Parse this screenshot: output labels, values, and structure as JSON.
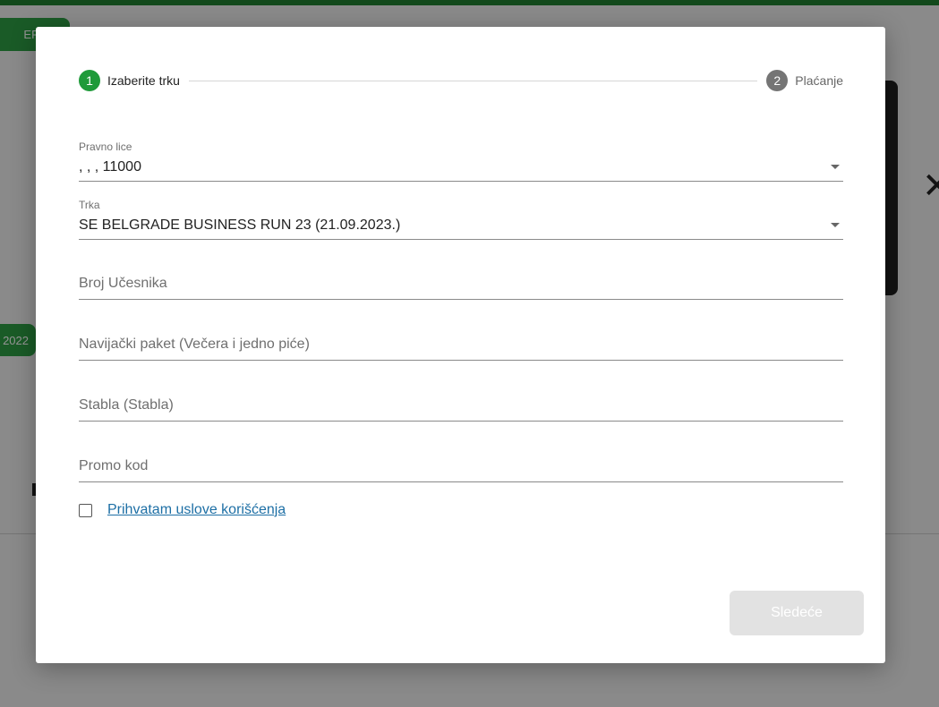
{
  "background": {
    "pill_top": "ERVAC",
    "pill_mid": "2022",
    "close_glyph": "✕"
  },
  "stepper": {
    "steps": [
      {
        "number": "1",
        "label": "Izaberite trku",
        "state": "active"
      },
      {
        "number": "2",
        "label": "Plaćanje",
        "state": "inactive"
      }
    ]
  },
  "form": {
    "legal_entity": {
      "label": "Pravno lice",
      "value": ", , , 11000"
    },
    "race": {
      "label": "Trka",
      "value": "SE BELGRADE BUSINESS RUN 23 (21.09.2023.)"
    },
    "participants": {
      "placeholder": "Broj Učesnika"
    },
    "fan_package": {
      "placeholder": "Navijački paket (Večera i jedno piće)"
    },
    "trees": {
      "placeholder": "Stabla (Stabla)"
    },
    "promo_code": {
      "placeholder": "Promo kod"
    },
    "terms": {
      "label": "Prihvatam uslove korišćenja",
      "checked": false
    }
  },
  "actions": {
    "next_label": "Sledeće",
    "next_disabled": true
  },
  "colors": {
    "accent": "#1f9a3a",
    "link": "#1d6fa5",
    "disabled_button": "#e2e2e2"
  }
}
